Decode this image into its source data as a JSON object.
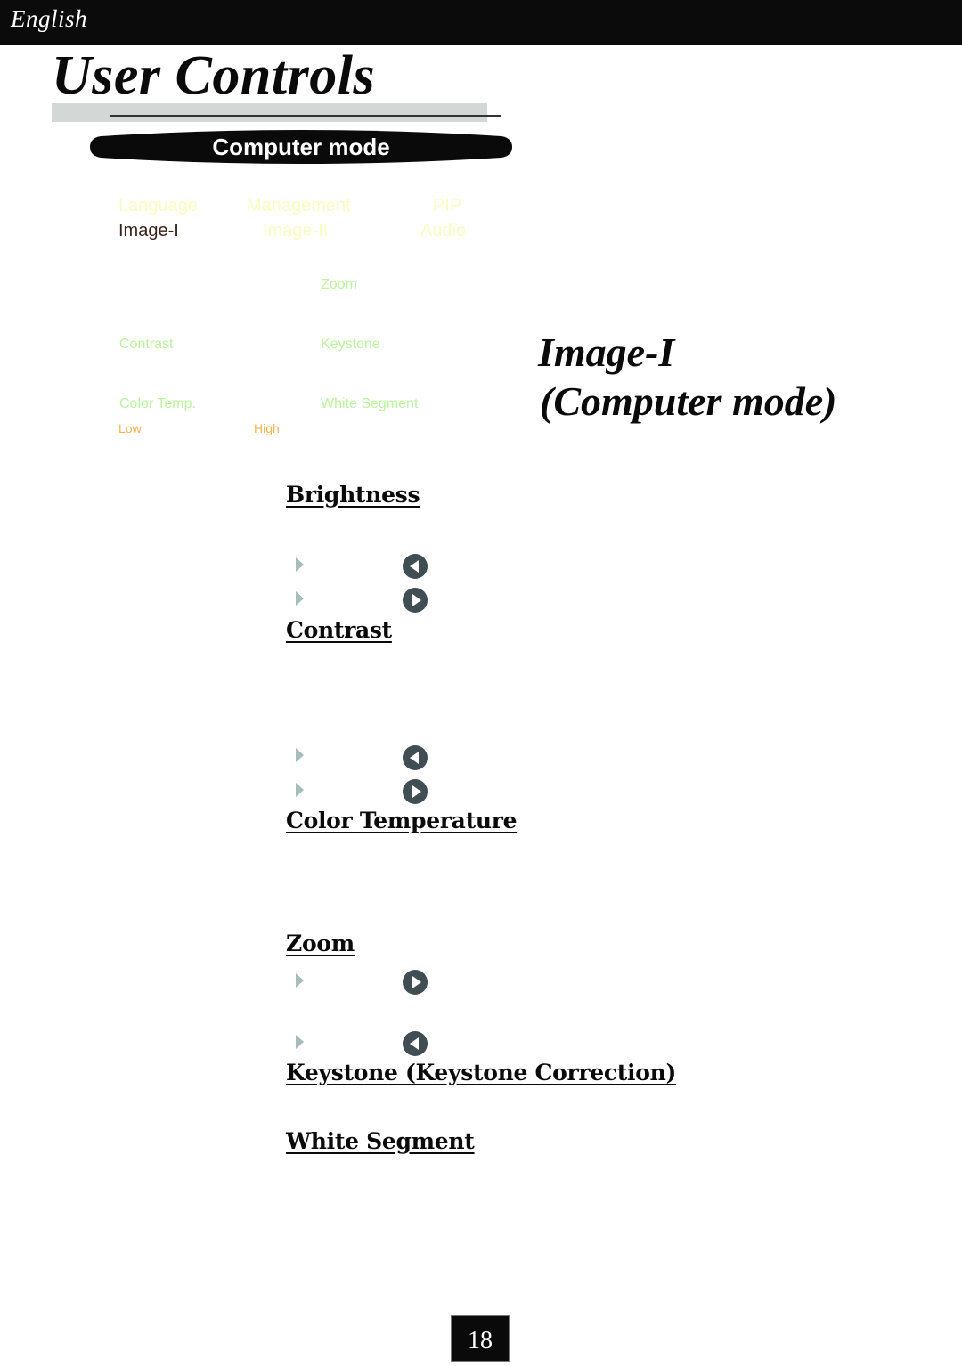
{
  "header": {
    "language": "English",
    "title": "User Controls",
    "mode_banner": "Computer mode"
  },
  "osd_menu": {
    "tabs_row1": [
      "Language",
      "Management",
      "PIP"
    ],
    "tabs_row2": [
      "Image-I",
      "Image-II",
      "Audio"
    ],
    "active_tab": "Image-I",
    "items": {
      "zoom": "Zoom",
      "contrast": "Contrast",
      "keystone": "Keystone",
      "color_temp": "Color Temp.",
      "white_segment": "White Segment"
    },
    "range_low": "Low",
    "range_high": "High",
    "colors": {
      "faint_tab": "#fdfbc2",
      "item_text": "#b9f59b",
      "range_text": "#f7b24b",
      "active_tab": "#3a2418"
    }
  },
  "side_title": {
    "line1": "Image-I",
    "line2": "(Computer mode)"
  },
  "sections": {
    "brightness": {
      "heading": "Brightness",
      "buttons": [
        "left",
        "right"
      ]
    },
    "contrast": {
      "heading": "Contrast",
      "buttons": [
        "left",
        "right"
      ]
    },
    "color_temperature": {
      "heading": "Color Temperature"
    },
    "zoom": {
      "heading": "Zoom",
      "buttons": [
        "right",
        "left"
      ]
    },
    "keystone": {
      "heading": "Keystone (Keystone Correction)"
    },
    "white_segment": {
      "heading": "White Segment"
    }
  },
  "footer": {
    "page_number": "18"
  }
}
